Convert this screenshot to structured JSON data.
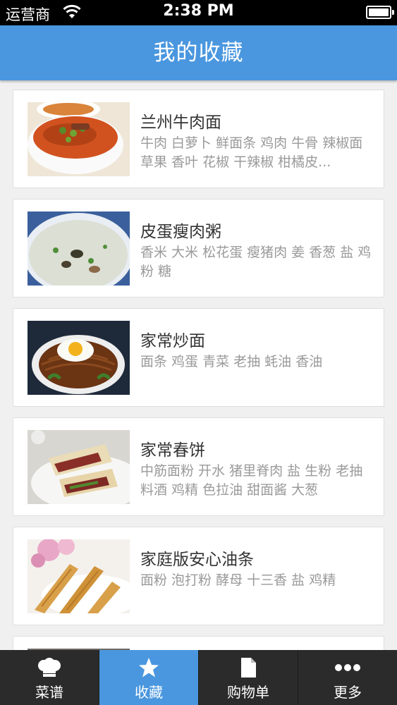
{
  "status_bar": {
    "carrier": "运营商",
    "time": "2:38 PM"
  },
  "header": {
    "title": "我的收藏"
  },
  "recipes": [
    {
      "title": "兰州牛肉面",
      "ingredients": "牛肉 白萝卜 鲜面条 鸡肉 牛骨 辣椒面 草果 香叶 花椒 干辣椒 柑橘皮..."
    },
    {
      "title": "皮蛋瘦肉粥",
      "ingredients": "香米 大米 松花蛋 瘦猪肉 姜 香葱 盐 鸡粉 糖"
    },
    {
      "title": "家常炒面",
      "ingredients": "面条 鸡蛋 青菜 老抽 蚝油 香油"
    },
    {
      "title": "家常春饼",
      "ingredients": "中筋面粉 开水 猪里脊肉 盐 生粉 老抽 料酒 鸡精 色拉油 甜面酱 大葱"
    },
    {
      "title": "家庭版安心油条",
      "ingredients": "面粉 泡打粉 酵母 十三香 盐 鸡精"
    }
  ],
  "tabs": [
    {
      "label": "菜谱",
      "icon": "chef-hat-icon",
      "active": false
    },
    {
      "label": "收藏",
      "icon": "star-icon",
      "active": true
    },
    {
      "label": "购物单",
      "icon": "document-icon",
      "active": false
    },
    {
      "label": "更多",
      "icon": "more-dots-icon",
      "active": false
    }
  ],
  "colors": {
    "accent": "#4a97df",
    "tab_bar": "#2b2b2b",
    "status_bar": "#000000"
  }
}
